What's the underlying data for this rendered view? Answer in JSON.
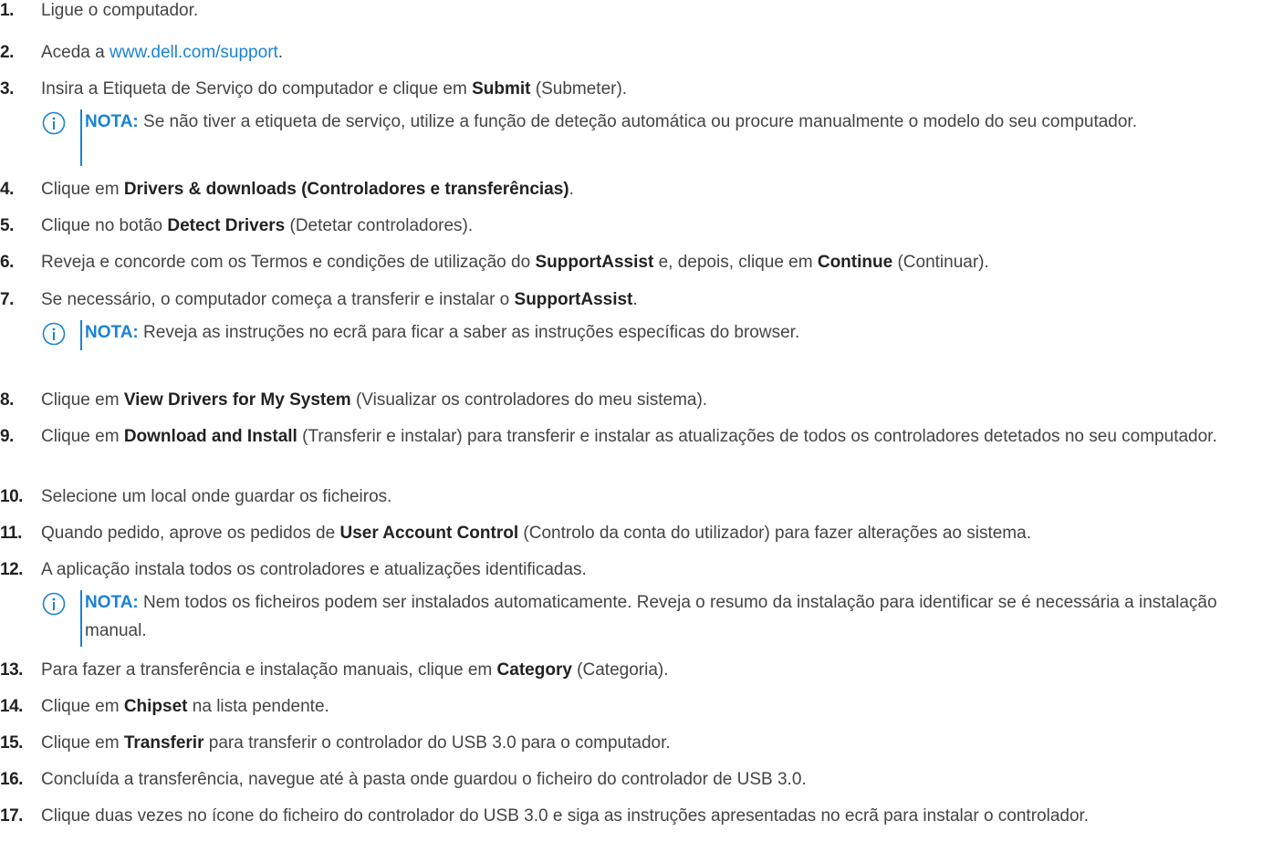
{
  "steps": [
    {
      "n": "1.",
      "parts": [
        {
          "t": "Ligue o computador."
        }
      ]
    },
    {
      "n": "2.",
      "parts": [
        {
          "t": "Aceda a "
        },
        {
          "t": "www.dell.com/support",
          "link": true
        },
        {
          "t": "."
        }
      ]
    },
    {
      "n": "3.",
      "parts": [
        {
          "t": "Insira a Etiqueta de Serviço do computador e clique em "
        },
        {
          "t": "Submit",
          "b": true
        },
        {
          "t": " (Submeter)."
        }
      ]
    },
    {
      "n": "4.",
      "parts": [
        {
          "t": "Clique em "
        },
        {
          "t": "Drivers & downloads (Controladores e transferências)",
          "b": true
        },
        {
          "t": "."
        }
      ]
    },
    {
      "n": "5.",
      "parts": [
        {
          "t": "Clique no botão "
        },
        {
          "t": "Detect Drivers",
          "b": true
        },
        {
          "t": " (Detetar controladores)."
        }
      ]
    },
    {
      "n": "6.",
      "parts": [
        {
          "t": "Reveja e concorde com os Termos e condições de utilização do "
        },
        {
          "t": "SupportAssist",
          "b": true
        },
        {
          "t": " e, depois, clique em "
        },
        {
          "t": "Continue",
          "b": true
        },
        {
          "t": " (Continuar)."
        }
      ]
    },
    {
      "n": "7.",
      "parts": [
        {
          "t": "Se necessário, o computador começa a transferir e instalar o "
        },
        {
          "t": "SupportAssist",
          "b": true
        },
        {
          "t": "."
        }
      ]
    },
    {
      "n": "8.",
      "parts": [
        {
          "t": "Clique em "
        },
        {
          "t": "View Drivers for My System",
          "b": true
        },
        {
          "t": " (Visualizar os controladores do meu sistema)."
        }
      ]
    },
    {
      "n": "9.",
      "parts": [
        {
          "t": "Clique em "
        },
        {
          "t": "Download and Install",
          "b": true
        },
        {
          "t": " (Transferir e instalar) para transferir e instalar as atualizações de todos os controladores detetados no seu computador."
        }
      ]
    },
    {
      "n": "10.",
      "parts": [
        {
          "t": "Selecione um local onde guardar os ficheiros."
        }
      ]
    },
    {
      "n": "11.",
      "parts": [
        {
          "t": "Quando pedido, aprove os pedidos de "
        },
        {
          "t": "User Account Control",
          "b": true
        },
        {
          "t": " (Controlo da conta do utilizador) para fazer alterações ao sistema."
        }
      ]
    },
    {
      "n": "12.",
      "parts": [
        {
          "t": "A aplicação instala todos os controladores e atualizações identificadas."
        }
      ]
    },
    {
      "n": "13.",
      "parts": [
        {
          "t": "Para fazer a transferência e instalação manuais, clique em "
        },
        {
          "t": "Category",
          "b": true
        },
        {
          "t": " (Categoria)."
        }
      ]
    },
    {
      "n": "14.",
      "parts": [
        {
          "t": "Clique em "
        },
        {
          "t": "Chipset",
          "b": true
        },
        {
          "t": " na lista pendente."
        }
      ]
    },
    {
      "n": "15.",
      "parts": [
        {
          "t": "Clique em "
        },
        {
          "t": "Transferir",
          "b": true
        },
        {
          "t": " para transferir o controlador do USB 3.0 para o computador."
        }
      ]
    },
    {
      "n": "16.",
      "parts": [
        {
          "t": "Concluída a transferência, navegue até à pasta onde guardou o ficheiro do controlador de USB 3.0."
        }
      ]
    },
    {
      "n": "17.",
      "parts": [
        {
          "t": "Clique duas vezes no ícone do ficheiro do controlador do USB 3.0 e siga as instruções apresentadas no ecrã para instalar o controlador."
        }
      ]
    }
  ],
  "notes": [
    {
      "label": "NOTA:",
      "text": " Se não tiver a etiqueta de serviço, utilize a função de deteção automática ou procure manualmente o modelo do seu computador."
    },
    {
      "label": "NOTA:",
      "text": " Reveja as instruções no ecrã para ficar a saber as instruções específicas do browser."
    },
    {
      "label": "NOTA:",
      "text": " Nem todos os ficheiros podem ser instalados automaticamente. Reveja o resumo da instalação para identificar se é necessária a instalação manual."
    }
  ],
  "colors": {
    "link": "#1a82d6",
    "text": "#444444",
    "note_label": "#1a82d6"
  },
  "icons": {
    "note": "info-circle-icon"
  }
}
